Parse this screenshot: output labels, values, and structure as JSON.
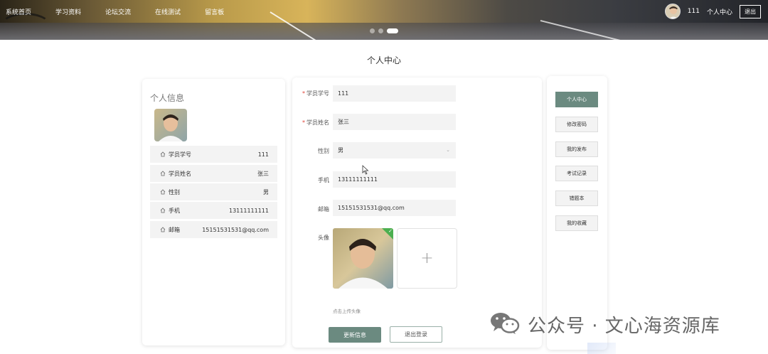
{
  "header": {
    "nav": [
      {
        "label": "系统首页"
      },
      {
        "label": "学习资料"
      },
      {
        "label": "论坛交流"
      },
      {
        "label": "在线测试"
      },
      {
        "label": "留言板"
      }
    ],
    "username": "111",
    "user_center": "个人中心",
    "logout": "退出",
    "carousel": {
      "count": 3,
      "active_index": 2
    }
  },
  "page_title": "个人中心",
  "profile_card": {
    "heading": "个人信息",
    "rows": [
      {
        "label": "学员学号",
        "value": "111"
      },
      {
        "label": "学员姓名",
        "value": "张三"
      },
      {
        "label": "性别",
        "value": "男"
      },
      {
        "label": "手机",
        "value": "13111111111"
      },
      {
        "label": "邮箱",
        "value": "15151531531@qq.com"
      }
    ]
  },
  "form": {
    "student_id": {
      "label": "学员学号",
      "value": "111",
      "required": true
    },
    "name": {
      "label": "学员姓名",
      "value": "张三",
      "required": true
    },
    "gender": {
      "label": "性别",
      "value": "男"
    },
    "phone": {
      "label": "手机",
      "value": "13111111111"
    },
    "email": {
      "label": "邮箱",
      "value": "15151531531@qq.com"
    },
    "avatar": {
      "label": "头像",
      "add_symbol": "+",
      "tip": "点击上传头像"
    },
    "required_mark": "*",
    "update_button": "更新信息",
    "logout_button": "退出登录"
  },
  "side_menu": [
    {
      "label": "个人中心",
      "active": true
    },
    {
      "label": "修改密码",
      "active": false
    },
    {
      "label": "我的发布",
      "active": false
    },
    {
      "label": "考试记录",
      "active": false
    },
    {
      "label": "错题本",
      "active": false
    },
    {
      "label": "我的收藏",
      "active": false
    }
  ],
  "watermark": {
    "text": "公众号 · 文心海资源库",
    "icon": "wechat-icon"
  },
  "colors": {
    "accent": "#6b8a80",
    "required": "#e0443a",
    "field_bg": "#f3f3f3"
  }
}
